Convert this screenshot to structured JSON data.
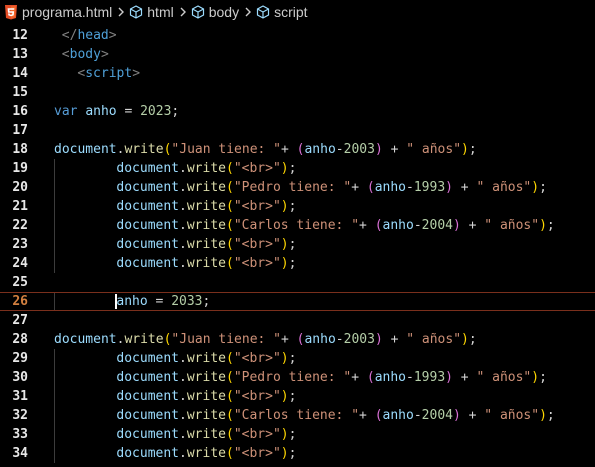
{
  "breadcrumb": {
    "file": "programa.html",
    "items": [
      "html",
      "body",
      "script"
    ]
  },
  "editor": {
    "active_line": 26,
    "lines": [
      {
        "n": "12",
        "indent": 1,
        "tokens": [
          [
            "tag",
            "</"
          ],
          [
            "tagname",
            "head"
          ],
          [
            "tag",
            ">"
          ]
        ]
      },
      {
        "n": "13",
        "indent": 1,
        "tokens": [
          [
            "tag",
            "<"
          ],
          [
            "tagname",
            "body"
          ],
          [
            "tag",
            ">"
          ]
        ]
      },
      {
        "n": "14",
        "indent": 3,
        "tokens": [
          [
            "tag",
            "<"
          ],
          [
            "tagname",
            "script"
          ],
          [
            "tag",
            ">"
          ]
        ]
      },
      {
        "n": "15",
        "indent": 0,
        "tokens": []
      },
      {
        "n": "16",
        "indent": 0,
        "tokens": [
          [
            "kw",
            "var"
          ],
          [
            "plain",
            " "
          ],
          [
            "var",
            "anho"
          ],
          [
            "plain",
            " = "
          ],
          [
            "num",
            "2023"
          ],
          [
            "plain",
            ";"
          ]
        ]
      },
      {
        "n": "17",
        "indent": 0,
        "tokens": []
      },
      {
        "n": "18",
        "indent": 0,
        "tokens": [
          [
            "var",
            "document"
          ],
          [
            "plain",
            "."
          ],
          [
            "fn",
            "write"
          ],
          [
            "paren",
            "("
          ],
          [
            "str",
            "\"Juan tiene: \""
          ],
          [
            "plain",
            "+ "
          ],
          [
            "paren2",
            "("
          ],
          [
            "var",
            "anho"
          ],
          [
            "plain",
            "-"
          ],
          [
            "num",
            "2003"
          ],
          [
            "paren2",
            ")"
          ],
          [
            "plain",
            " + "
          ],
          [
            "str",
            "\" años\""
          ],
          [
            "paren",
            ")"
          ],
          [
            "plain",
            ";"
          ]
        ]
      },
      {
        "n": "19",
        "indent": 8,
        "tokens": [
          [
            "var",
            "document"
          ],
          [
            "plain",
            "."
          ],
          [
            "fn",
            "write"
          ],
          [
            "paren",
            "("
          ],
          [
            "str",
            "\"<br>\""
          ],
          [
            "paren",
            ")"
          ],
          [
            "plain",
            ";"
          ]
        ]
      },
      {
        "n": "20",
        "indent": 8,
        "tokens": [
          [
            "var",
            "document"
          ],
          [
            "plain",
            "."
          ],
          [
            "fn",
            "write"
          ],
          [
            "paren",
            "("
          ],
          [
            "str",
            "\"Pedro tiene: \""
          ],
          [
            "plain",
            "+ "
          ],
          [
            "paren2",
            "("
          ],
          [
            "var",
            "anho"
          ],
          [
            "plain",
            "-"
          ],
          [
            "num",
            "1993"
          ],
          [
            "paren2",
            ")"
          ],
          [
            "plain",
            " + "
          ],
          [
            "str",
            "\" años\""
          ],
          [
            "paren",
            ")"
          ],
          [
            "plain",
            ";"
          ]
        ]
      },
      {
        "n": "21",
        "indent": 8,
        "tokens": [
          [
            "var",
            "document"
          ],
          [
            "plain",
            "."
          ],
          [
            "fn",
            "write"
          ],
          [
            "paren",
            "("
          ],
          [
            "str",
            "\"<br>\""
          ],
          [
            "paren",
            ")"
          ],
          [
            "plain",
            ";"
          ]
        ]
      },
      {
        "n": "22",
        "indent": 8,
        "tokens": [
          [
            "var",
            "document"
          ],
          [
            "plain",
            "."
          ],
          [
            "fn",
            "write"
          ],
          [
            "paren",
            "("
          ],
          [
            "str",
            "\"Carlos tiene: \""
          ],
          [
            "plain",
            "+ "
          ],
          [
            "paren2",
            "("
          ],
          [
            "var",
            "anho"
          ],
          [
            "plain",
            "-"
          ],
          [
            "num",
            "2004"
          ],
          [
            "paren2",
            ")"
          ],
          [
            "plain",
            " + "
          ],
          [
            "str",
            "\" años\""
          ],
          [
            "paren",
            ")"
          ],
          [
            "plain",
            ";"
          ]
        ]
      },
      {
        "n": "23",
        "indent": 8,
        "tokens": [
          [
            "var",
            "document"
          ],
          [
            "plain",
            "."
          ],
          [
            "fn",
            "write"
          ],
          [
            "paren",
            "("
          ],
          [
            "str",
            "\"<br>\""
          ],
          [
            "paren",
            ")"
          ],
          [
            "plain",
            ";"
          ]
        ]
      },
      {
        "n": "24",
        "indent": 8,
        "tokens": [
          [
            "var",
            "document"
          ],
          [
            "plain",
            "."
          ],
          [
            "fn",
            "write"
          ],
          [
            "paren",
            "("
          ],
          [
            "str",
            "\"<br>\""
          ],
          [
            "paren",
            ")"
          ],
          [
            "plain",
            ";"
          ]
        ]
      },
      {
        "n": "25",
        "indent": 0,
        "tokens": []
      },
      {
        "n": "26",
        "indent": 8,
        "tokens": [
          [
            "var",
            "anho"
          ],
          [
            "plain",
            " = "
          ],
          [
            "num",
            "2033"
          ],
          [
            "plain",
            ";"
          ]
        ]
      },
      {
        "n": "27",
        "indent": 0,
        "tokens": []
      },
      {
        "n": "28",
        "indent": 0,
        "tokens": [
          [
            "var",
            "document"
          ],
          [
            "plain",
            "."
          ],
          [
            "fn",
            "write"
          ],
          [
            "paren",
            "("
          ],
          [
            "str",
            "\"Juan tiene: \""
          ],
          [
            "plain",
            "+ "
          ],
          [
            "paren2",
            "("
          ],
          [
            "var",
            "anho"
          ],
          [
            "plain",
            "-"
          ],
          [
            "num",
            "2003"
          ],
          [
            "paren2",
            ")"
          ],
          [
            "plain",
            " + "
          ],
          [
            "str",
            "\" años\""
          ],
          [
            "paren",
            ")"
          ],
          [
            "plain",
            ";"
          ]
        ]
      },
      {
        "n": "29",
        "indent": 8,
        "tokens": [
          [
            "var",
            "document"
          ],
          [
            "plain",
            "."
          ],
          [
            "fn",
            "write"
          ],
          [
            "paren",
            "("
          ],
          [
            "str",
            "\"<br>\""
          ],
          [
            "paren",
            ")"
          ],
          [
            "plain",
            ";"
          ]
        ]
      },
      {
        "n": "30",
        "indent": 8,
        "tokens": [
          [
            "var",
            "document"
          ],
          [
            "plain",
            "."
          ],
          [
            "fn",
            "write"
          ],
          [
            "paren",
            "("
          ],
          [
            "str",
            "\"Pedro tiene: \""
          ],
          [
            "plain",
            "+ "
          ],
          [
            "paren2",
            "("
          ],
          [
            "var",
            "anho"
          ],
          [
            "plain",
            "-"
          ],
          [
            "num",
            "1993"
          ],
          [
            "paren2",
            ")"
          ],
          [
            "plain",
            " + "
          ],
          [
            "str",
            "\" años\""
          ],
          [
            "paren",
            ")"
          ],
          [
            "plain",
            ";"
          ]
        ]
      },
      {
        "n": "31",
        "indent": 8,
        "tokens": [
          [
            "var",
            "document"
          ],
          [
            "plain",
            "."
          ],
          [
            "fn",
            "write"
          ],
          [
            "paren",
            "("
          ],
          [
            "str",
            "\"<br>\""
          ],
          [
            "paren",
            ")"
          ],
          [
            "plain",
            ";"
          ]
        ]
      },
      {
        "n": "32",
        "indent": 8,
        "tokens": [
          [
            "var",
            "document"
          ],
          [
            "plain",
            "."
          ],
          [
            "fn",
            "write"
          ],
          [
            "paren",
            "("
          ],
          [
            "str",
            "\"Carlos tiene: \""
          ],
          [
            "plain",
            "+ "
          ],
          [
            "paren2",
            "("
          ],
          [
            "var",
            "anho"
          ],
          [
            "plain",
            "-"
          ],
          [
            "num",
            "2004"
          ],
          [
            "paren2",
            ")"
          ],
          [
            "plain",
            " + "
          ],
          [
            "str",
            "\" años\""
          ],
          [
            "paren",
            ")"
          ],
          [
            "plain",
            ";"
          ]
        ]
      },
      {
        "n": "33",
        "indent": 8,
        "tokens": [
          [
            "var",
            "document"
          ],
          [
            "plain",
            "."
          ],
          [
            "fn",
            "write"
          ],
          [
            "paren",
            "("
          ],
          [
            "str",
            "\"<br>\""
          ],
          [
            "paren",
            ")"
          ],
          [
            "plain",
            ";"
          ]
        ]
      },
      {
        "n": "34",
        "indent": 8,
        "tokens": [
          [
            "var",
            "document"
          ],
          [
            "plain",
            "."
          ],
          [
            "fn",
            "write"
          ],
          [
            "paren",
            "("
          ],
          [
            "str",
            "\"<br>\""
          ],
          [
            "paren",
            ")"
          ],
          [
            "plain",
            ";"
          ]
        ]
      }
    ]
  },
  "colors": {
    "background": "#000000",
    "active_line_border": "#7a2f1c",
    "html5_icon": "#e44d26"
  }
}
